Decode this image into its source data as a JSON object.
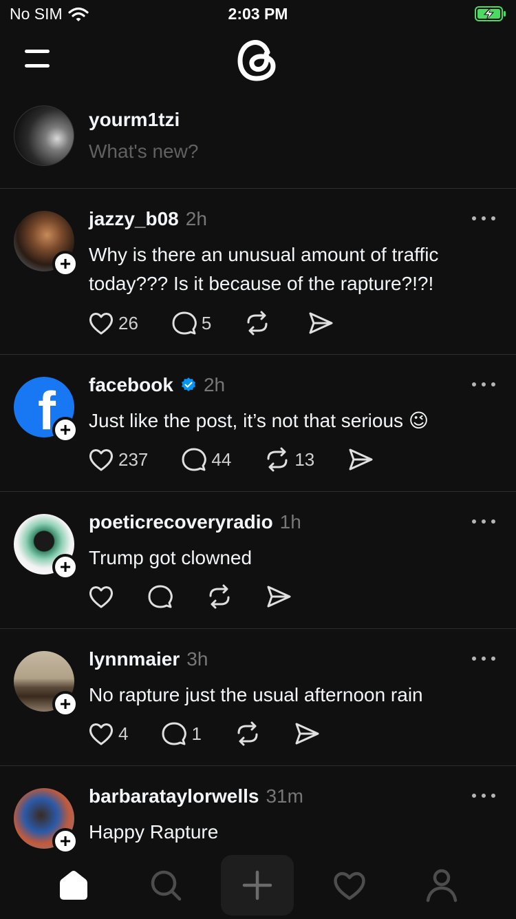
{
  "status_bar": {
    "carrier": "No SIM",
    "time": "2:03 PM"
  },
  "header": {
    "logo": "threads-logo-icon",
    "menu": "menu-icon"
  },
  "composer": {
    "username": "yourm1tzi",
    "placeholder": "What's new?"
  },
  "posts": [
    {
      "username": "jazzy_b08",
      "time": "2h",
      "verified": false,
      "text": "Why is there an unusual amount of traffic today??? Is it because of the rapture?!?!",
      "likes": "26",
      "replies": "5",
      "reposts": ""
    },
    {
      "username": "facebook",
      "time": "2h",
      "verified": true,
      "text": "Just like the post, it’s not that serious 😉",
      "likes": "237",
      "replies": "44",
      "reposts": "13"
    },
    {
      "username": "poeticrecoveryradio",
      "time": "1h",
      "verified": false,
      "text": "Trump got clowned",
      "likes": "",
      "replies": "",
      "reposts": ""
    },
    {
      "username": "lynnmaier",
      "time": "3h",
      "verified": false,
      "text": "No rapture just the usual afternoon rain",
      "likes": "4",
      "replies": "1",
      "reposts": ""
    },
    {
      "username": "barbarataylorwells",
      "time": "31m",
      "verified": false,
      "text": "Happy Rapture",
      "likes": "",
      "replies": "",
      "reposts": ""
    }
  ],
  "tabs": [
    "home-icon",
    "search-icon",
    "create-icon",
    "activity-heart-icon",
    "profile-icon"
  ],
  "colors": {
    "background": "#101010",
    "text": "#f3f5f7",
    "muted": "#777777",
    "verified": "#0095f6",
    "facebook_blue": "#1877f2"
  }
}
